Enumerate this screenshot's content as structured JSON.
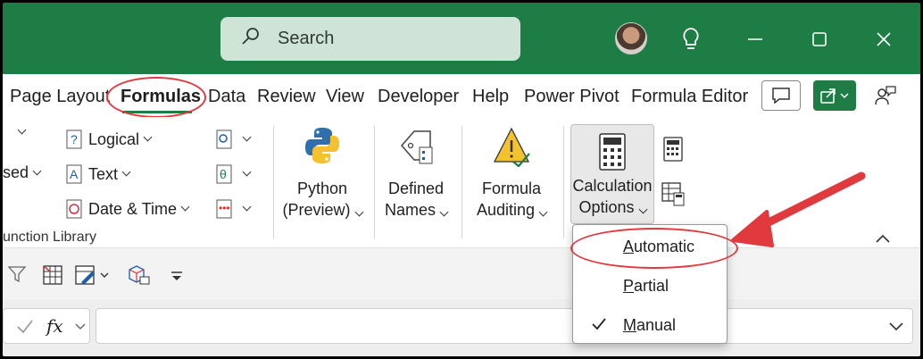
{
  "titlebar": {
    "search_placeholder": "Search",
    "icons": [
      "search-icon",
      "avatar",
      "lightbulb-icon",
      "minimize-icon",
      "maximize-icon",
      "close-icon"
    ]
  },
  "menu": {
    "tabs": [
      "Page Layout",
      "Formulas",
      "Data",
      "Review",
      "View",
      "Developer",
      "Help",
      "Power Pivot",
      "Formula Editor"
    ],
    "active_tab": "Formulas"
  },
  "ribbon": {
    "function_library": {
      "left_cut_label": "sed",
      "logical": "Logical",
      "text": "Text",
      "date_time": "Date & Time",
      "group_label": "unction Library"
    },
    "python": {
      "line1": "Python",
      "line2": "(Preview)"
    },
    "defined_names": {
      "line1": "Defined",
      "line2": "Names"
    },
    "formula_auditing": {
      "line1": "Formula",
      "line2": "Auditing"
    },
    "calculation_options": {
      "line1": "Calculation",
      "line2": "Options"
    }
  },
  "dropdown": {
    "items": [
      {
        "prefix": "",
        "underlined": "A",
        "rest": "utomatic",
        "checked": false
      },
      {
        "prefix": "",
        "underlined": "P",
        "rest": "artial",
        "checked": false
      },
      {
        "prefix": "",
        "underlined": "M",
        "rest": "anual",
        "checked": true
      }
    ]
  },
  "formula_bar": {
    "fx_label": "fx"
  },
  "colors": {
    "title_green": "#1e7d45",
    "annotation_red": "#e0393e"
  }
}
